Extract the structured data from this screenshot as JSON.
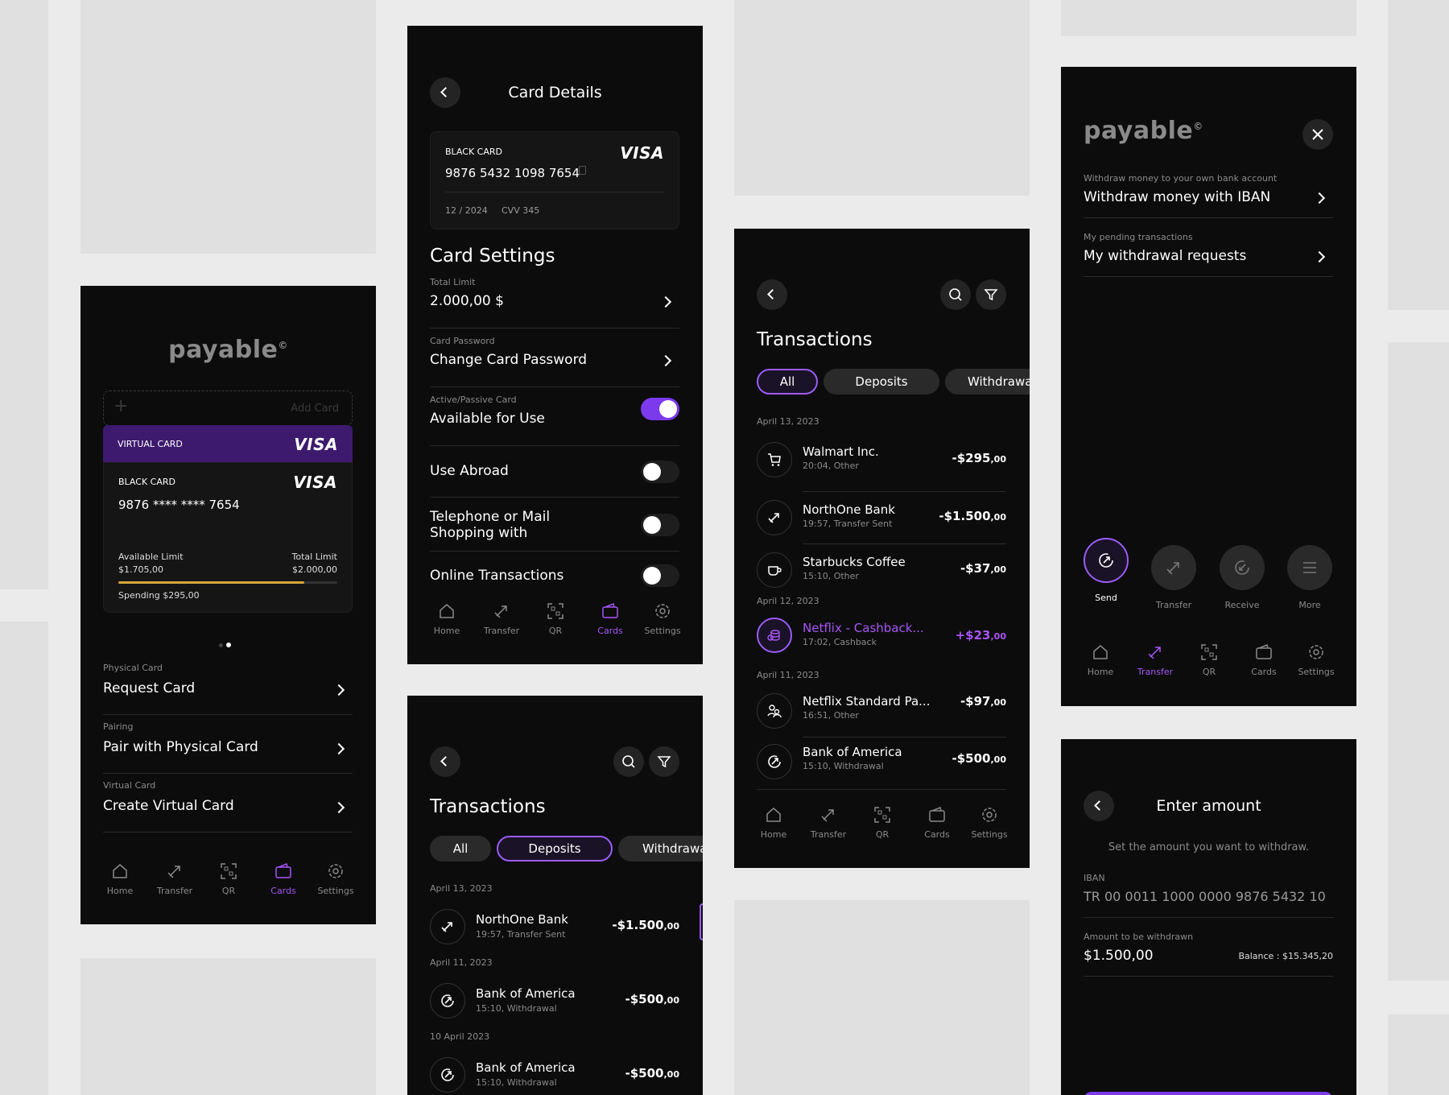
{
  "brand": {
    "logo": "payable",
    "logo_mark": "©",
    "accent": "#7c3aed"
  },
  "nav": {
    "home": "Home",
    "transfer": "Transfer",
    "qr": "QR",
    "cards": "Cards",
    "settings": "Settings"
  },
  "cards_screen": {
    "add_card": "Add Card",
    "virtual_card_label": "VIRTUAL CARD",
    "black_card_label": "BLACK CARD",
    "visa": "VISA",
    "card_number": "9876 **** **** 7654",
    "available_limit_label": "Available Limit",
    "available_limit_value": "$1.705,00",
    "total_limit_label": "Total Limit",
    "total_limit_value": "$2.000,00",
    "spending": "Spending $295,00",
    "spending_fraction": 0.85,
    "items": [
      {
        "label": "Physical Card",
        "title": "Request Card"
      },
      {
        "label": "Pairing",
        "title": "Pair with Physical Card"
      },
      {
        "label": "Virtual Card",
        "title": "Create Virtual Card"
      }
    ]
  },
  "card_details": {
    "title": "Card Details",
    "card_label": "BLACK CARD",
    "visa": "VISA",
    "card_number": "9876 5432 1098 7654",
    "expiry": "12 / 2024",
    "cvv": "CVV 345",
    "settings_title": "Card Settings",
    "total_limit_label": "Total Limit",
    "total_limit_value": "2.000,00 $",
    "password_label": "Card Password",
    "password_title": "Change Card Password",
    "active_label": "Active/Passive Card",
    "active_title": "Available for Use",
    "active_on": true,
    "use_abroad": "Use Abroad",
    "use_abroad_on": false,
    "telephone_line1": "Telephone or Mail",
    "telephone_line2": "Shopping with",
    "telephone_on": false,
    "online": "Online Transactions",
    "online_on": false
  },
  "transactions_deposits": {
    "title": "Transactions",
    "filters": [
      "All",
      "Deposits",
      "Withdrawa"
    ],
    "active_filter": "Deposits",
    "groups": [
      {
        "date": "April 13, 2023",
        "items": [
          {
            "name": "NorthOne Bank",
            "sub": "19:57, Transfer Sent",
            "amount": "-$1.500",
            "cents": ",00"
          }
        ]
      },
      {
        "date": "April 11, 2023",
        "items": [
          {
            "name": "Bank of America",
            "sub": "15:10, Withdrawal",
            "amount": "-$500",
            "cents": ",00"
          }
        ]
      },
      {
        "date": "10 April 2023",
        "items": [
          {
            "name": "Bank of America",
            "sub": "15:10, Withdrawal",
            "amount": "-$500",
            "cents": ",00"
          }
        ]
      }
    ]
  },
  "transactions_all": {
    "title": "Transactions",
    "filters": [
      "All",
      "Deposits",
      "Withdrawa"
    ],
    "active_filter": "All",
    "date1": "April 13, 2023",
    "date2": "April 12, 2023",
    "date3": "April 11, 2023",
    "tx": [
      {
        "name": "Walmart Inc.",
        "sub": "20:04, Other",
        "amount": "-$295",
        "cents": ",00",
        "icon": "cart-icon"
      },
      {
        "name": "NorthOne Bank",
        "sub": "19:57, Transfer Sent",
        "amount": "-$1.500",
        "cents": ",00",
        "icon": "transfer-icon"
      },
      {
        "name": "Starbucks Coffee",
        "sub": "15:10, Other",
        "amount": "-$37",
        "cents": ",00",
        "icon": "coffee-icon"
      },
      {
        "name": "Netflix - Cashback...",
        "sub": "17:02, Cashback",
        "amount": "+$23",
        "cents": ",00",
        "icon": "coins-icon"
      },
      {
        "name": "Netflix Standard Pa...",
        "sub": "16:51, Other",
        "amount": "-$97",
        "cents": ",00",
        "icon": "people-icon"
      },
      {
        "name": "Bank of America",
        "sub": "15:10, Withdrawal",
        "amount": "-$500",
        "cents": ",00",
        "icon": "withdraw-icon"
      }
    ]
  },
  "transfer_menu": {
    "item1_label": "Withdraw money to your own bank account",
    "item1_title": "Withdraw money with IBAN",
    "item2_label": "My pending transactions",
    "item2_title": "My withdrawal requests",
    "actions": [
      "Send",
      "Transfer",
      "Receive",
      "More"
    ]
  },
  "enter_amount": {
    "title": "Enter amount",
    "subtitle": "Set the amount you want to withdraw.",
    "iban_label": "IBAN",
    "iban_value": "TR 00 0011 1000 0000 9876 5432 10",
    "amount_label": "Amount to be withdrawn",
    "amount_value": "$1.500,00",
    "balance": "Balance : $15.345,20"
  }
}
